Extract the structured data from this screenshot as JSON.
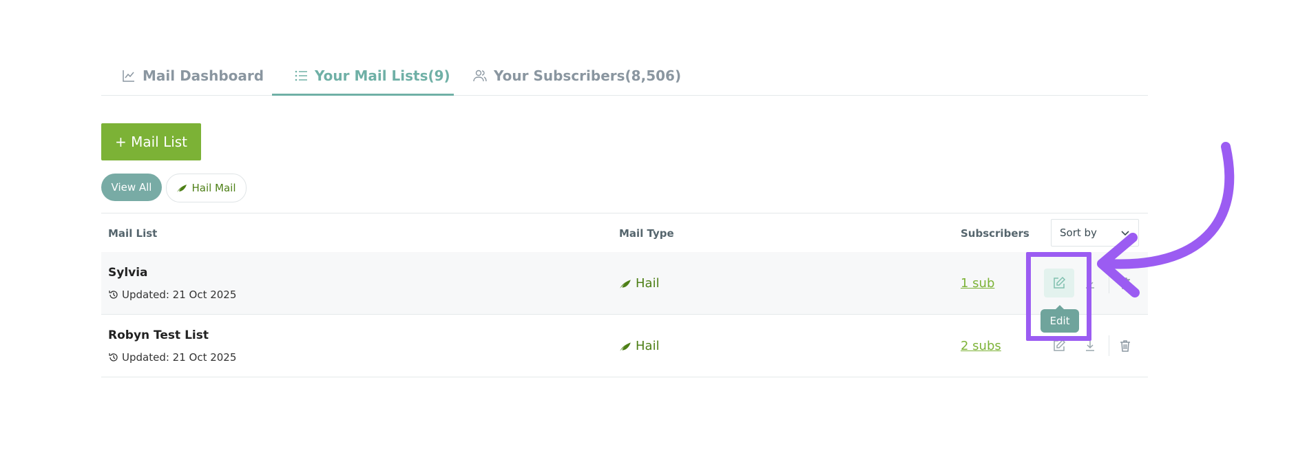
{
  "tabs": [
    {
      "label": "Mail Dashboard",
      "icon": "line-chart-icon",
      "active": false
    },
    {
      "label": "Your Mail Lists(9)",
      "icon": "list-icon",
      "active": true
    },
    {
      "label": "Your Subscribers(8,506)",
      "icon": "users-icon",
      "active": false
    }
  ],
  "toolbar": {
    "add_button_label": "+ Mail List"
  },
  "filters": {
    "view_all_label": "View All",
    "hail_mail_label": "Hail Mail"
  },
  "table": {
    "columns": {
      "mail_list": "Mail List",
      "mail_type": "Mail Type",
      "subscribers": "Subscribers"
    },
    "sort_label": "Sort by",
    "rows": [
      {
        "name": "Sylvia",
        "updated": "Updated: 21 Oct 2025",
        "type": "Hail",
        "subscribers": "1 sub"
      },
      {
        "name": "Robyn Test List",
        "updated": "Updated: 21 Oct 2025",
        "type": "Hail",
        "subscribers": "2 subs"
      }
    ]
  },
  "tooltip": {
    "edit_label": "Edit"
  },
  "colors": {
    "accent": "#6fb0a6",
    "primary_button": "#7cb236",
    "hail_green": "#4d7f16",
    "annotation": "#9b5cf2"
  }
}
